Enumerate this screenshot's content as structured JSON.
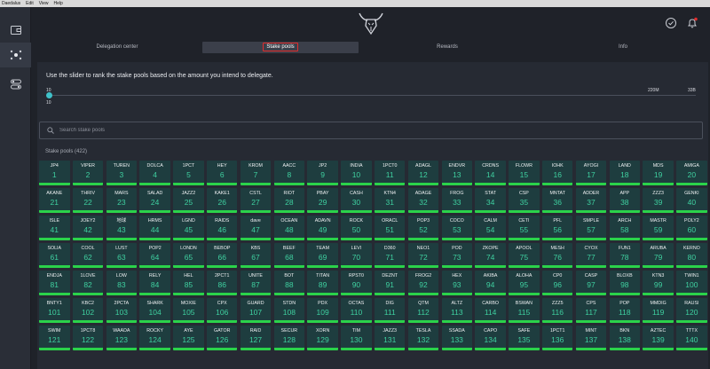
{
  "menu": [
    "Daedalus",
    "Edit",
    "View",
    "Help"
  ],
  "sidebar": {
    "items": [
      {
        "name": "wallet",
        "active": false
      },
      {
        "name": "stake-pools",
        "active": true
      },
      {
        "name": "settings",
        "active": false
      }
    ]
  },
  "colors": {
    "accent": "#3fc1c9",
    "green": "#2bd24a",
    "highlight": "#e02d2d"
  },
  "tabs": [
    {
      "label": "Delegation center",
      "active": false
    },
    {
      "label": "Stake pools",
      "active": true
    },
    {
      "label": "Rewards",
      "active": false
    },
    {
      "label": "Info",
      "active": false
    }
  ],
  "main": {
    "instruction": "Use the slider to rank the stake pools based on the amount you intend to delegate.",
    "slider": {
      "min": "10",
      "value": "10",
      "mid": "220M",
      "max": "33B"
    },
    "search_placeholder": "Search stake pools",
    "pool_count": "Stake pools (422)"
  },
  "pools": [
    {
      "ticker": "JP4",
      "rank": "1"
    },
    {
      "ticker": "VIPER",
      "rank": "2"
    },
    {
      "ticker": "TUREN",
      "rank": "3"
    },
    {
      "ticker": "DOLCA",
      "rank": "4"
    },
    {
      "ticker": "1PCT",
      "rank": "5"
    },
    {
      "ticker": "HEY",
      "rank": "6"
    },
    {
      "ticker": "KROM",
      "rank": "7"
    },
    {
      "ticker": "AACC",
      "rank": "8"
    },
    {
      "ticker": "JP2",
      "rank": "9"
    },
    {
      "ticker": "INDIA",
      "rank": "10"
    },
    {
      "ticker": "1PCT0",
      "rank": "11"
    },
    {
      "ticker": "ADAGL",
      "rank": "12"
    },
    {
      "ticker": "ENDVR",
      "rank": "13"
    },
    {
      "ticker": "CRDNS",
      "rank": "14"
    },
    {
      "ticker": "FLOWR",
      "rank": "15"
    },
    {
      "ticker": "IOHK",
      "rank": "16"
    },
    {
      "ticker": "AYOGI",
      "rank": "17"
    },
    {
      "ticker": "LAND",
      "rank": "18"
    },
    {
      "ticker": "MDS",
      "rank": "19"
    },
    {
      "ticker": "AMIGA",
      "rank": "20"
    },
    {
      "ticker": "AKANE",
      "rank": "21"
    },
    {
      "ticker": "THRIV",
      "rank": "22"
    },
    {
      "ticker": "MARS",
      "rank": "23"
    },
    {
      "ticker": "SALAD",
      "rank": "24"
    },
    {
      "ticker": "JAZZ2",
      "rank": "25"
    },
    {
      "ticker": "KAKE1",
      "rank": "26"
    },
    {
      "ticker": "CSTL",
      "rank": "27"
    },
    {
      "ticker": "RIOT",
      "rank": "28"
    },
    {
      "ticker": "PBAY",
      "rank": "29"
    },
    {
      "ticker": "CASH",
      "rank": "30"
    },
    {
      "ticker": "KTN4",
      "rank": "31"
    },
    {
      "ticker": "ADAGE",
      "rank": "32"
    },
    {
      "ticker": "FROG",
      "rank": "33"
    },
    {
      "ticker": "STAT",
      "rank": "34"
    },
    {
      "ticker": "CSP",
      "rank": "35"
    },
    {
      "ticker": "MNTAT",
      "rank": "36"
    },
    {
      "ticker": "ADDER",
      "rank": "37"
    },
    {
      "ticker": "APP",
      "rank": "38"
    },
    {
      "ticker": "ZZZ3",
      "rank": "39"
    },
    {
      "ticker": "GENKI",
      "rank": "40"
    },
    {
      "ticker": "ISLE",
      "rank": "41"
    },
    {
      "ticker": "JOEY2",
      "rank": "42"
    },
    {
      "ticker": "地球",
      "rank": "43"
    },
    {
      "ticker": "HRMS",
      "rank": "44"
    },
    {
      "ticker": "LGND",
      "rank": "45"
    },
    {
      "ticker": "RAIDS",
      "rank": "46"
    },
    {
      "ticker": "dave",
      "rank": "47"
    },
    {
      "ticker": "OCEAN",
      "rank": "48"
    },
    {
      "ticker": "ADAVN",
      "rank": "49"
    },
    {
      "ticker": "ROCK",
      "rank": "50"
    },
    {
      "ticker": "ORACL",
      "rank": "51"
    },
    {
      "ticker": "POP3",
      "rank": "52"
    },
    {
      "ticker": "COCO",
      "rank": "53"
    },
    {
      "ticker": "CALM",
      "rank": "54"
    },
    {
      "ticker": "CETI",
      "rank": "55"
    },
    {
      "ticker": "PFL",
      "rank": "56"
    },
    {
      "ticker": "SMPLE",
      "rank": "57"
    },
    {
      "ticker": "ARCH",
      "rank": "58"
    },
    {
      "ticker": "MASTR",
      "rank": "59"
    },
    {
      "ticker": "POLY2",
      "rank": "60"
    },
    {
      "ticker": "SOLIA",
      "rank": "61"
    },
    {
      "ticker": "COOL",
      "rank": "62"
    },
    {
      "ticker": "LUST",
      "rank": "63"
    },
    {
      "ticker": "POP2",
      "rank": "64"
    },
    {
      "ticker": "LONDN",
      "rank": "65"
    },
    {
      "ticker": "BEBOP",
      "rank": "66"
    },
    {
      "ticker": "KBS",
      "rank": "67"
    },
    {
      "ticker": "BEEF",
      "rank": "68"
    },
    {
      "ticker": "TEAM",
      "rank": "69"
    },
    {
      "ticker": "LEVI",
      "rank": "70"
    },
    {
      "ticker": "D360",
      "rank": "71"
    },
    {
      "ticker": "NEO1",
      "rank": "72"
    },
    {
      "ticker": "POD",
      "rank": "73"
    },
    {
      "ticker": "ZKOPE",
      "rank": "74"
    },
    {
      "ticker": "APOOL",
      "rank": "75"
    },
    {
      "ticker": "MESH",
      "rank": "76"
    },
    {
      "ticker": "CYOX",
      "rank": "77"
    },
    {
      "ticker": "FUN1",
      "rank": "78"
    },
    {
      "ticker": "ARUBA",
      "rank": "79"
    },
    {
      "ticker": "KERNO",
      "rank": "80"
    },
    {
      "ticker": "ENDJA",
      "rank": "81"
    },
    {
      "ticker": "1LOVE",
      "rank": "82"
    },
    {
      "ticker": "LOW",
      "rank": "83"
    },
    {
      "ticker": "RELY",
      "rank": "84"
    },
    {
      "ticker": "HEL",
      "rank": "85"
    },
    {
      "ticker": "2PCT1",
      "rank": "86"
    },
    {
      "ticker": "UNITE",
      "rank": "87"
    },
    {
      "ticker": "BOT",
      "rank": "88"
    },
    {
      "ticker": "TITAN",
      "rank": "89"
    },
    {
      "ticker": "RPST0",
      "rank": "90"
    },
    {
      "ticker": "DEZNT",
      "rank": "91"
    },
    {
      "ticker": "FROG2",
      "rank": "92"
    },
    {
      "ticker": "HEX",
      "rank": "93"
    },
    {
      "ticker": "AKIBA",
      "rank": "94"
    },
    {
      "ticker": "ALOHA",
      "rank": "95"
    },
    {
      "ticker": "CP0",
      "rank": "96"
    },
    {
      "ticker": "CASP",
      "rank": "97"
    },
    {
      "ticker": "BLOXB",
      "rank": "98"
    },
    {
      "ticker": "KTN3",
      "rank": "99"
    },
    {
      "ticker": "TWIN1",
      "rank": "100"
    },
    {
      "ticker": "BNTY1",
      "rank": "101"
    },
    {
      "ticker": "KBC2",
      "rank": "102"
    },
    {
      "ticker": "2PCTA",
      "rank": "103"
    },
    {
      "ticker": "SHARK",
      "rank": "104"
    },
    {
      "ticker": "MOXIE",
      "rank": "105"
    },
    {
      "ticker": "CPX",
      "rank": "106"
    },
    {
      "ticker": "GUARD",
      "rank": "107"
    },
    {
      "ticker": "STDN",
      "rank": "108"
    },
    {
      "ticker": "PDX",
      "rank": "109"
    },
    {
      "ticker": "OCTAS",
      "rank": "110"
    },
    {
      "ticker": "DIG",
      "rank": "111"
    },
    {
      "ticker": "QTM",
      "rank": "112"
    },
    {
      "ticker": "ALTZ",
      "rank": "113"
    },
    {
      "ticker": "CARBO",
      "rank": "114"
    },
    {
      "ticker": "BSWAN",
      "rank": "115"
    },
    {
      "ticker": "ZZZ5",
      "rank": "116"
    },
    {
      "ticker": "CPS",
      "rank": "117"
    },
    {
      "ticker": "POP",
      "rank": "118"
    },
    {
      "ticker": "MMDIG",
      "rank": "119"
    },
    {
      "ticker": "RAUSI",
      "rank": "120"
    },
    {
      "ticker": "SWIM",
      "rank": "121"
    },
    {
      "ticker": "1PCT8",
      "rank": "122"
    },
    {
      "ticker": "WAADA",
      "rank": "123"
    },
    {
      "ticker": "ROCKY",
      "rank": "124"
    },
    {
      "ticker": "AYE",
      "rank": "125"
    },
    {
      "ticker": "GATOR",
      "rank": "126"
    },
    {
      "ticker": "RAID",
      "rank": "127"
    },
    {
      "ticker": "SECUR",
      "rank": "128"
    },
    {
      "ticker": "XORN",
      "rank": "129"
    },
    {
      "ticker": "TIM",
      "rank": "130"
    },
    {
      "ticker": "JAZZ3",
      "rank": "131"
    },
    {
      "ticker": "TESLA",
      "rank": "132"
    },
    {
      "ticker": "SSADA",
      "rank": "133"
    },
    {
      "ticker": "CAPO",
      "rank": "134"
    },
    {
      "ticker": "SAFE",
      "rank": "135"
    },
    {
      "ticker": "1PCT1",
      "rank": "136"
    },
    {
      "ticker": "MINT",
      "rank": "137"
    },
    {
      "ticker": "BKN",
      "rank": "138"
    },
    {
      "ticker": "AZTEC",
      "rank": "139"
    },
    {
      "ticker": "TTTX",
      "rank": "140"
    }
  ]
}
